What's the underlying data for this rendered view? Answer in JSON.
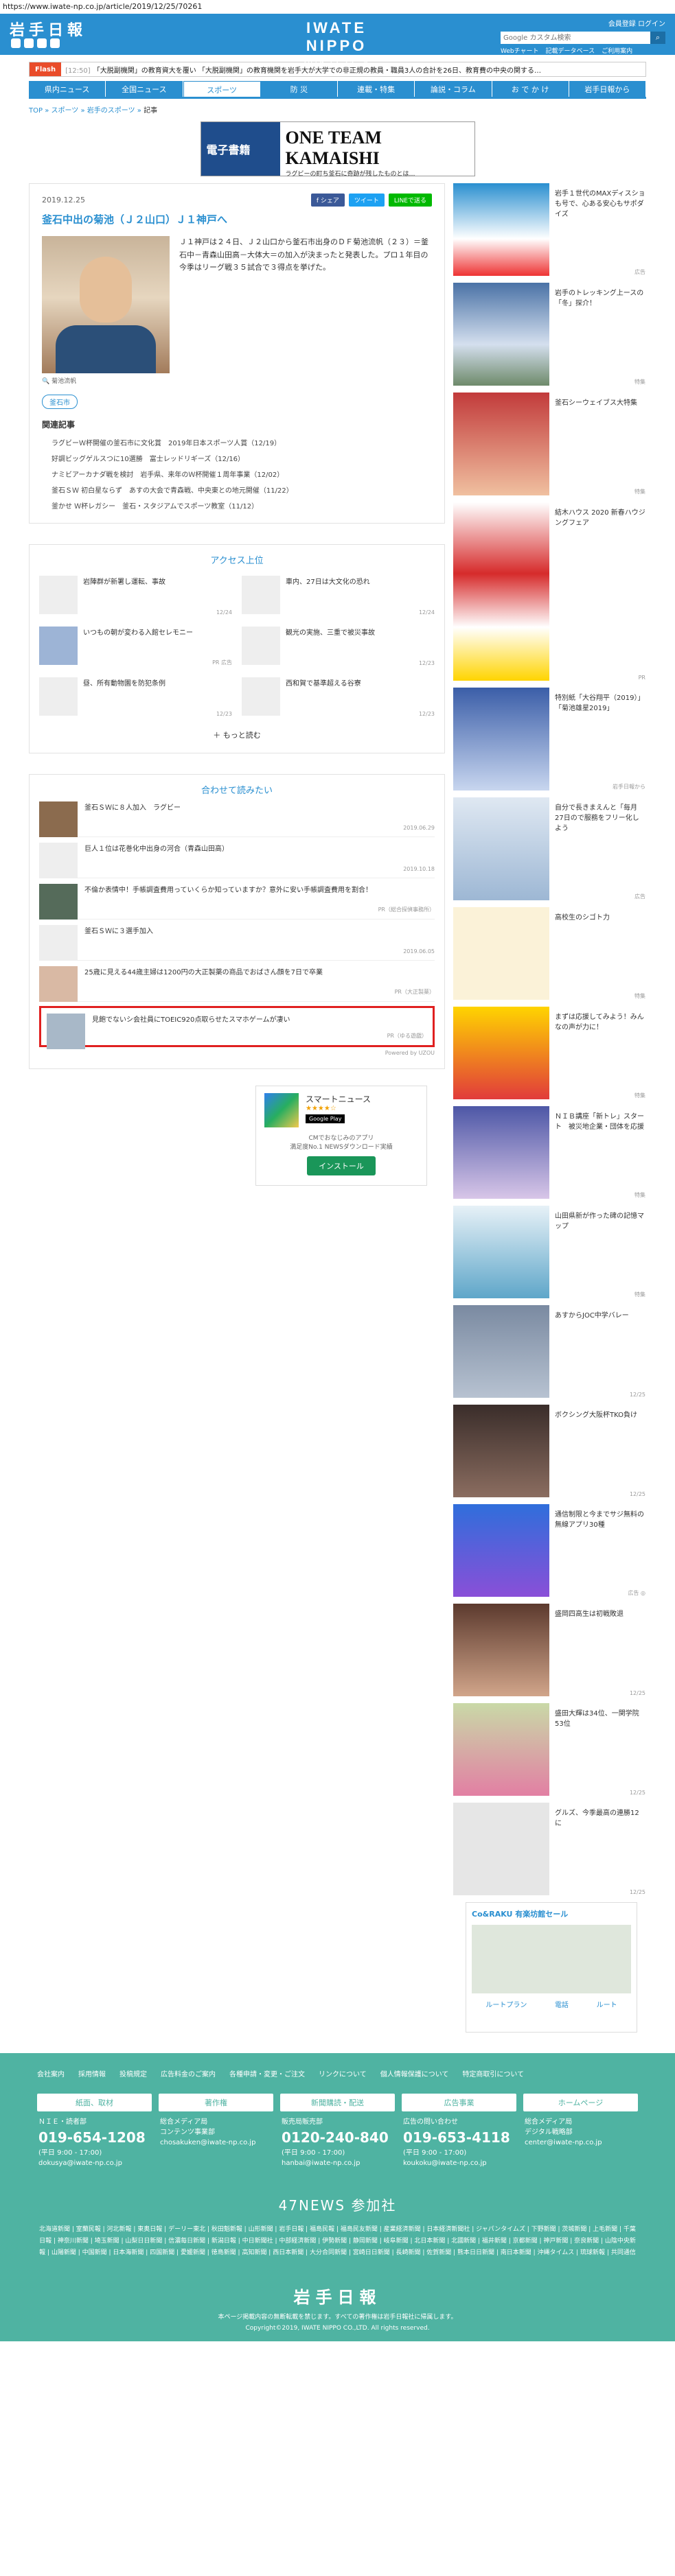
{
  "url": "https://www.iwate-np.co.jp/article/2019/12/25/70261",
  "header": {
    "logo_left": "岩手日報",
    "center_logo": "IWATE NIPPO",
    "date": "2019.12.25. 水",
    "login": "会員登録 ログイン",
    "search_placeholder": "Google カスタム検索",
    "links": [
      "Webチャート",
      "記載データベース",
      "ご利用案内"
    ]
  },
  "ticker": {
    "flash": "Flash",
    "time": "[12:50]",
    "text": "「大脱副機関」の教育資大を覆い 「大脱副機関」の教育機関を岩手大が大学での非正規の教員・職員3人の合計を26日、教育費の中央の関する…"
  },
  "nav": [
    "県内ニュース",
    "全国ニュース",
    "スポーツ",
    "防 災",
    "連載・特集",
    "論説・コラム",
    "お で か け",
    "岩手日報から"
  ],
  "crumb": {
    "items": [
      "TOP",
      "スポーツ",
      "岩手のスポーツ"
    ],
    "current": "記事"
  },
  "banner": {
    "left": "電子書籍",
    "left_sub": "",
    "title": "ONE TEAM KAMAISHI",
    "sub": "ラグビーの町ち釜石に奇跡が残したものとは…"
  },
  "article": {
    "date": "2019.12.25",
    "share": {
      "fb": "f シェア",
      "tw": "ツイート",
      "ln": "LINEで送る"
    },
    "title": "釜石中出の菊池（Ｊ２山口）Ｊ１神戸へ",
    "body": "Ｊ１神戸は２４日、Ｊ２山口から釜石市出身のＤＦ菊池流帆（２３）＝釜石中－青森山田高－大体大＝の加入が決まったと発表した。プロ１年目の今季はリーグ戦３５試合で３得点を挙げた。",
    "caption": "菊池流帆",
    "tag": "釜石市",
    "related_title": "関連記事",
    "related": [
      "ラグビーＷ杯開催の釜石市に文化賞　2019年日本スポーツ人賞（12/19）",
      "好調ビッグゲルスつに10選勝　富士レッドリギーズ（12/16）",
      "ナミビアーカナダ戦を検討　岩手県、来年のＷ杯開催１周年事業（12/02）",
      "釜石ＳＷ 初白星ならず　あすの大会で青森戦、中央東との地元開催（11/22）",
      "釜かせ Ｗ杯レガシー　釜石・スタジアムでスポーツ教室（11/12）"
    ]
  },
  "access": {
    "title": "アクセス上位",
    "items": [
      {
        "text": "岩陣群が新署し運転、事故",
        "date": "12/24"
      },
      {
        "text": "車内、27日は大文化の恐れ",
        "date": "12/24"
      },
      {
        "text": "いつもの朝が変わる入館セレモニー",
        "date": "PR 広告"
      },
      {
        "text": "観光の実施、三重で被災事故",
        "date": "12/23"
      },
      {
        "text": "昼、所有動物園を防犯条例",
        "date": "12/23"
      },
      {
        "text": "西和賀で基準超える谷寮",
        "date": "12/23"
      }
    ],
    "more": "もっと読む"
  },
  "recommend": {
    "title": "合わせて読みたい",
    "items": [
      {
        "text": "釜石ＳＷに８人加入　ラグビー",
        "date": "2019.06.29"
      },
      {
        "text": "巨人１位は花巻化中出身の河合（青森山田高）",
        "date": "2019.10.18"
      },
      {
        "text": "不倫か表情中！手帳調査費用っていくらか知っていますか？意外に安い手帳調査費用を割合！",
        "date": "PR（総合探偵事務所）"
      },
      {
        "text": "釜石ＳＷに３選手加入",
        "date": "2019.06.05"
      },
      {
        "text": "25歳に見える44歳主婦は1200円の大正製薬の商品でおばさん顔を7日で卒業",
        "date": "PR（大正製薬）"
      },
      {
        "text": "見飽でないシ会社員にTOEIC920点取らせたスマホゲームが凄い",
        "date": "PR（ゆる遊戯）"
      }
    ],
    "powered": "Powered by UZOU"
  },
  "app_ad": {
    "title": "スマートニュース",
    "stars": "★★★★☆",
    "store": "Google Play",
    "desc1": "CMでおなじみのアプリ",
    "desc2": "満足度No.1 NEWSダウンロード実績",
    "install": "インストール"
  },
  "side": [
    {
      "text": "岩手１世代のMAXディスショも号で、心ある安心もサポダイズ",
      "date": "広告"
    },
    {
      "text": "岩手のトレッキング上ースの「冬」探介！",
      "date": "特集"
    },
    {
      "text": "釜石シーウェイブス大特集",
      "date": "特集"
    },
    {
      "text": "結木ハウス 2020 新春ハウジングフェア",
      "date": "PR"
    },
    {
      "text": "特別紙「大谷翔平（2019）」「菊池雄星2019」",
      "date": "岩手日報から"
    },
    {
      "text": "自分で長きまえんと「毎月27日ので服務をフリー化しよう",
      "date": "広告"
    },
    {
      "text": "高校生のシゴト力",
      "date": "特集"
    },
    {
      "text": "まずは応援してみよう！みんなの声が力に！",
      "date": "特集"
    },
    {
      "text": "ＮＩＢ講座「新トレ」スタート　被災地企業・団体を応援",
      "date": "特集"
    },
    {
      "text": "山田県新が作った碑の記憶マップ",
      "date": "特集"
    },
    {
      "text": "あすからJOC中学バレー",
      "date": "12/25"
    },
    {
      "text": "ボクシング大阪杯TKO負け",
      "date": "12/25"
    },
    {
      "text": "通信制限と今までサジ無料の無線アプリ30種",
      "date": "広告 ◎"
    },
    {
      "text": "盛岡四高生は初戦敗退",
      "date": "12/25"
    },
    {
      "text": "盛田大輝は34位、一関学院53位",
      "date": "12/25"
    },
    {
      "text": "グルズ、今季最高の連勝12に",
      "date": "12/25"
    }
  ],
  "map_ad": {
    "title": "Co&RAKU 有楽坊館セール",
    "route": "ルートプラン",
    "call": "電話",
    "btn3": "ルート"
  },
  "footer": {
    "links": [
      "会社案内",
      "採用情報",
      "投稿規定",
      "広告料金のご案内",
      "各種申請・変更・ご注文",
      "リンクについて",
      "個人情報保護について",
      "特定商取引について"
    ],
    "cols": [
      {
        "head": "紙面、取材",
        "l1": "ＮＩＥ・読者部",
        "tel": "019-654-1208",
        "l2": "(平日 9:00 - 17:00)",
        "mail": "dokusya@iwate-np.co.jp"
      },
      {
        "head": "著作権",
        "l1": "総合メディア局",
        "tel": "",
        "l2": "コンテンツ事業部",
        "mail": "chosakuken@iwate-np.co.jp"
      },
      {
        "head": "新聞購読・配送",
        "l1": "販売局販売部",
        "tel": "0120-240-840",
        "l2": "(平日 9:00 - 17:00)",
        "mail": "hanbai@iwate-np.co.jp"
      },
      {
        "head": "広告事業",
        "l1": "広告の問い合わせ",
        "tel": "019-653-4118",
        "l2": "(平日 9:00 - 17:00)",
        "mail": "koukoku@iwate-np.co.jp"
      },
      {
        "head": "ホームページ",
        "l1": "総合メディア局",
        "tel": "",
        "l2": "デジタル戦略部",
        "mail": "center@iwate-np.co.jp"
      }
    ],
    "n47": "47NEWS 参加社",
    "n47_list": "北海道新聞 | 室蘭民報 | 河北新報 | 東奥日報 | デーリー東北 | 秋田魁新報 | 山形新聞 | 岩手日報 | 福島民報 | 福島民友新聞 | 産業経済新聞 | 日本経済新聞社 | ジャパンタイムズ | 下野新聞 | 茨城新聞 | 上毛新聞 | 千葉日報 | 神奈川新聞 | 埼玉新聞 | 山梨日日新聞 | 信濃毎日新聞 | 新潟日報 | 中日新聞社 | 中部経済新聞 | 伊勢新聞 | 静岡新聞 | 岐阜新聞 | 北日本新聞 | 北國新聞 | 福井新聞 | 京都新聞 | 神戸新聞 | 奈良新聞 | 山陰中央新報 | 山陽新聞 | 中国新聞 | 日本海新聞 | 四国新聞 | 愛媛新聞 | 徳島新聞 | 高知新聞 | 西日本新聞 | 大分合同新聞 | 宮崎日日新聞 | 長崎新聞 | 佐賀新聞 | 熊本日日新聞 | 南日本新聞 | 沖縄タイムス | 琉球新報 | 共同通信",
    "logo": "岩手日報",
    "copy": "本ページ掲載内容の無断転載を禁じます。すべての著作権は岩手日報社に帰属します。",
    "copyright": "Copyright©2019, IWATE NIPPO CO.,LTD. All rights reserved."
  }
}
